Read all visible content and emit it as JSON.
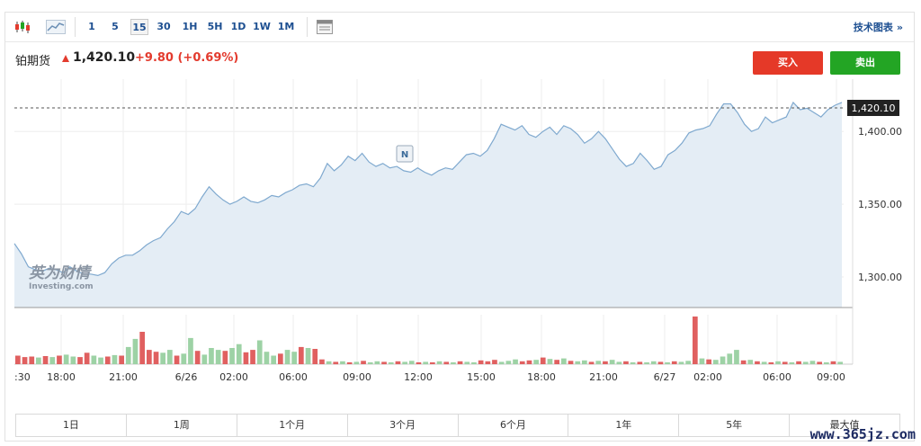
{
  "toolbar": {
    "intervals": [
      "1",
      "5",
      "15",
      "30",
      "1H",
      "5H",
      "1D",
      "1W",
      "1M"
    ],
    "active_interval": "15",
    "tech_link": "技术图表",
    "tech_arrow": "»"
  },
  "instrument": {
    "name": "铂期货",
    "price": "1,420.10",
    "change": "+9.80 (+0.69%)",
    "buy_label": "买入",
    "sell_label": "卖出"
  },
  "colors": {
    "up": "#e33b2e",
    "down": "#23a524",
    "line": "#7fa9cf",
    "area": "#e4edf5"
  },
  "chart_data": {
    "type": "area",
    "current_price_label": "1,420.10",
    "y_ticks": [
      "1,400.00",
      "1,350.00",
      "1,300.00"
    ],
    "y_tick_values": [
      1400,
      1350,
      1300
    ],
    "ylim": [
      1279,
      1436
    ],
    "x_ticks": [
      ":30",
      "18:00",
      "21:00",
      "6/26",
      "02:00",
      "06:00",
      "09:00",
      "12:00",
      "15:00",
      "18:00",
      "21:00",
      "6/27",
      "02:00",
      "06:00",
      "09:00"
    ],
    "news_marker": "N",
    "watermark_cn": "英为财情",
    "watermark_en": "Investing.com",
    "series": [
      {
        "values": [
          1323,
          1316,
          1307,
          1305,
          1304,
          1306,
          1305,
          1303,
          1307,
          1304,
          1302,
          1302,
          1301,
          1303,
          1309,
          1313,
          1315,
          1315,
          1318,
          1322,
          1325,
          1327,
          1333,
          1338,
          1345,
          1343,
          1347,
          1355,
          1362,
          1357,
          1353,
          1350,
          1352,
          1355,
          1352,
          1351,
          1353,
          1356,
          1355,
          1358,
          1360,
          1363,
          1364,
          1362,
          1368,
          1378,
          1373,
          1377,
          1383,
          1380,
          1385,
          1379,
          1376,
          1378,
          1375,
          1376,
          1373,
          1372,
          1375,
          1372,
          1370,
          1373,
          1375,
          1374,
          1379,
          1384,
          1385,
          1383,
          1387,
          1395,
          1405,
          1403,
          1401,
          1404,
          1398,
          1396,
          1400,
          1403,
          1398,
          1404,
          1402,
          1398,
          1392,
          1395,
          1400,
          1395,
          1388,
          1381,
          1376,
          1378,
          1385,
          1380,
          1374,
          1376,
          1384,
          1387,
          1392,
          1399,
          1401,
          1402,
          1404,
          1412,
          1419,
          1419,
          1413,
          1405,
          1400,
          1402,
          1410,
          1406,
          1408,
          1410,
          1420,
          1415,
          1416,
          1413,
          1410,
          1415,
          1418,
          1420
        ]
      }
    ],
    "volume": {
      "ylim": [
        0,
        100
      ],
      "values": [
        {
          "v": 18,
          "up": false
        },
        {
          "v": 15,
          "up": false
        },
        {
          "v": 16,
          "up": false
        },
        {
          "v": 14,
          "up": true
        },
        {
          "v": 17,
          "up": false
        },
        {
          "v": 15,
          "up": true
        },
        {
          "v": 18,
          "up": false
        },
        {
          "v": 20,
          "up": true
        },
        {
          "v": 16,
          "up": true
        },
        {
          "v": 15,
          "up": false
        },
        {
          "v": 24,
          "up": false
        },
        {
          "v": 18,
          "up": true
        },
        {
          "v": 14,
          "up": true
        },
        {
          "v": 16,
          "up": false
        },
        {
          "v": 19,
          "up": true
        },
        {
          "v": 18,
          "up": false
        },
        {
          "v": 36,
          "up": true
        },
        {
          "v": 53,
          "up": true
        },
        {
          "v": 68,
          "up": false
        },
        {
          "v": 30,
          "up": false
        },
        {
          "v": 26,
          "up": false
        },
        {
          "v": 24,
          "up": true
        },
        {
          "v": 30,
          "up": true
        },
        {
          "v": 18,
          "up": false
        },
        {
          "v": 22,
          "up": true
        },
        {
          "v": 55,
          "up": true
        },
        {
          "v": 28,
          "up": false
        },
        {
          "v": 20,
          "up": true
        },
        {
          "v": 34,
          "up": true
        },
        {
          "v": 30,
          "up": true
        },
        {
          "v": 28,
          "up": false
        },
        {
          "v": 34,
          "up": true
        },
        {
          "v": 42,
          "up": true
        },
        {
          "v": 25,
          "up": false
        },
        {
          "v": 30,
          "up": false
        },
        {
          "v": 50,
          "up": true
        },
        {
          "v": 26,
          "up": true
        },
        {
          "v": 18,
          "up": true
        },
        {
          "v": 22,
          "up": false
        },
        {
          "v": 30,
          "up": true
        },
        {
          "v": 26,
          "up": true
        },
        {
          "v": 36,
          "up": false
        },
        {
          "v": 34,
          "up": true
        },
        {
          "v": 32,
          "up": false
        },
        {
          "v": 10,
          "up": false
        },
        {
          "v": 6,
          "up": true
        },
        {
          "v": 5,
          "up": false
        },
        {
          "v": 6,
          "up": true
        },
        {
          "v": 4,
          "up": false
        },
        {
          "v": 5,
          "up": true
        },
        {
          "v": 7,
          "up": false
        },
        {
          "v": 4,
          "up": true
        },
        {
          "v": 6,
          "up": true
        },
        {
          "v": 5,
          "up": false
        },
        {
          "v": 4,
          "up": true
        },
        {
          "v": 6,
          "up": false
        },
        {
          "v": 5,
          "up": true
        },
        {
          "v": 7,
          "up": true
        },
        {
          "v": 4,
          "up": false
        },
        {
          "v": 5,
          "up": true
        },
        {
          "v": 4,
          "up": false
        },
        {
          "v": 6,
          "up": true
        },
        {
          "v": 5,
          "up": false
        },
        {
          "v": 4,
          "up": true
        },
        {
          "v": 6,
          "up": false
        },
        {
          "v": 5,
          "up": true
        },
        {
          "v": 4,
          "up": true
        },
        {
          "v": 8,
          "up": false
        },
        {
          "v": 6,
          "up": false
        },
        {
          "v": 9,
          "up": false
        },
        {
          "v": 5,
          "up": true
        },
        {
          "v": 7,
          "up": true
        },
        {
          "v": 10,
          "up": true
        },
        {
          "v": 6,
          "up": false
        },
        {
          "v": 8,
          "up": false
        },
        {
          "v": 9,
          "up": true
        },
        {
          "v": 14,
          "up": false
        },
        {
          "v": 11,
          "up": true
        },
        {
          "v": 9,
          "up": false
        },
        {
          "v": 12,
          "up": true
        },
        {
          "v": 7,
          "up": false
        },
        {
          "v": 6,
          "up": true
        },
        {
          "v": 8,
          "up": true
        },
        {
          "v": 5,
          "up": false
        },
        {
          "v": 7,
          "up": true
        },
        {
          "v": 6,
          "up": false
        },
        {
          "v": 9,
          "up": true
        },
        {
          "v": 5,
          "up": true
        },
        {
          "v": 6,
          "up": false
        },
        {
          "v": 4,
          "up": true
        },
        {
          "v": 5,
          "up": false
        },
        {
          "v": 4,
          "up": true
        },
        {
          "v": 6,
          "up": true
        },
        {
          "v": 5,
          "up": false
        },
        {
          "v": 4,
          "up": true
        },
        {
          "v": 6,
          "up": false
        },
        {
          "v": 5,
          "up": true
        },
        {
          "v": 7,
          "up": true
        },
        {
          "v": 100,
          "up": false
        },
        {
          "v": 12,
          "up": true
        },
        {
          "v": 10,
          "up": false
        },
        {
          "v": 9,
          "up": true
        },
        {
          "v": 16,
          "up": true
        },
        {
          "v": 22,
          "up": true
        },
        {
          "v": 30,
          "up": true
        },
        {
          "v": 8,
          "up": false
        },
        {
          "v": 9,
          "up": true
        },
        {
          "v": 6,
          "up": false
        },
        {
          "v": 5,
          "up": true
        },
        {
          "v": 4,
          "up": false
        },
        {
          "v": 6,
          "up": true
        },
        {
          "v": 5,
          "up": false
        },
        {
          "v": 4,
          "up": true
        },
        {
          "v": 6,
          "up": false
        },
        {
          "v": 5,
          "up": true
        },
        {
          "v": 7,
          "up": true
        },
        {
          "v": 5,
          "up": false
        },
        {
          "v": 4,
          "up": true
        },
        {
          "v": 6,
          "up": false
        },
        {
          "v": 5,
          "up": true
        }
      ]
    }
  },
  "ranges": [
    "1日",
    "1周",
    "1个月",
    "3个月",
    "6个月",
    "1年",
    "5年",
    "最大值"
  ],
  "watermark": "www.365jz.com"
}
